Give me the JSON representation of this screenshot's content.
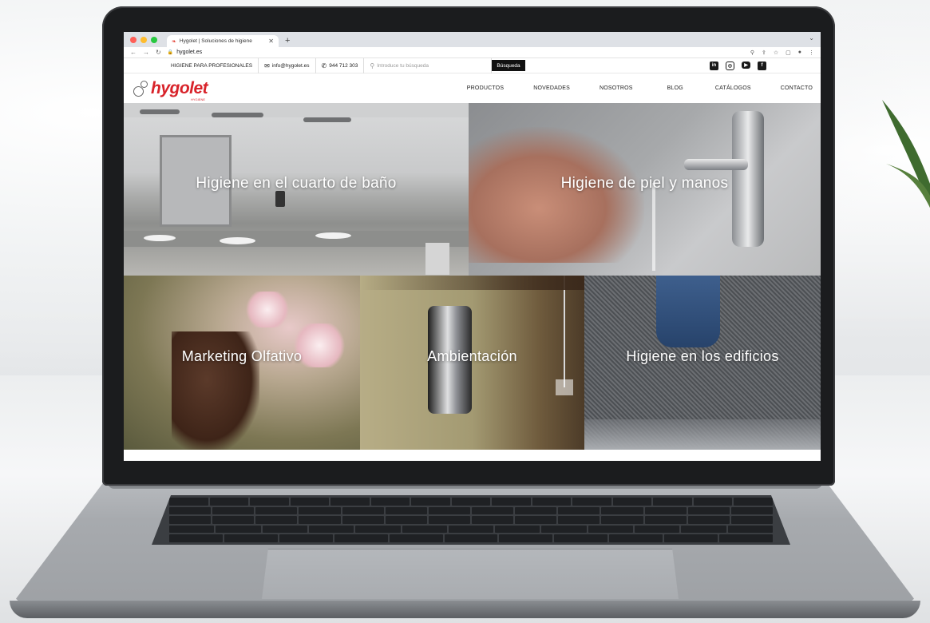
{
  "browser": {
    "tab_title": "Hygolet | Soluciones de higiene",
    "new_tab_symbol": "+",
    "url": "hygolet.es"
  },
  "topbar": {
    "tagline": "HIGIENE PARA PROFESIONALES",
    "email": "info@hygolet.es",
    "phone": "944 712 303",
    "search_placeholder": "Introduce tu búsqueda",
    "search_button": "Búsqueda",
    "socials": [
      "linkedin-icon",
      "instagram-icon",
      "youtube-icon",
      "facebook-icon"
    ]
  },
  "header": {
    "logo_brand": "hygolet",
    "logo_sub": "HYGIENE",
    "menu": [
      "PRODUCTOS",
      "NOVEDADES",
      "NOSOTROS",
      "BLOG",
      "CATÁLOGOS",
      "CONTACTO"
    ]
  },
  "tiles": [
    "Higiene en el cuarto de baño",
    "Higiene de piel y manos",
    "Marketing Olfativo",
    "Ambientación",
    "Higiene en los edificios"
  ],
  "colors": {
    "brand_red": "#d8232a",
    "dark": "#111111",
    "traffic_red": "#ff5f57",
    "traffic_yellow": "#febc2e",
    "traffic_green": "#28c840"
  }
}
